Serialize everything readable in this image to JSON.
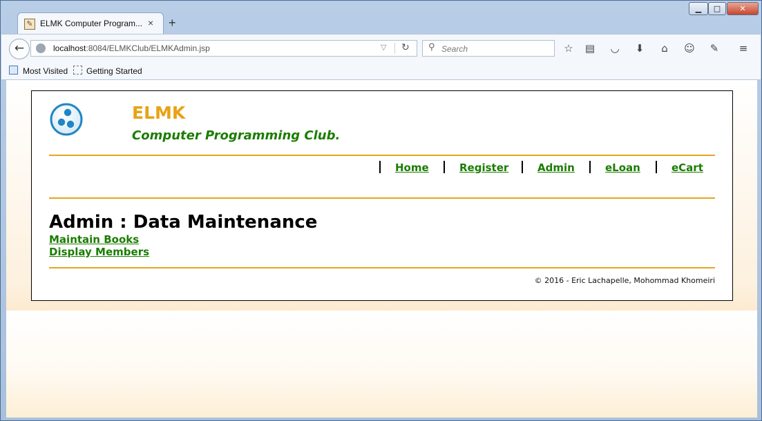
{
  "browser": {
    "tab_title": "ELMK Computer Program...",
    "tab_close": "×",
    "new_tab": "+",
    "url_host": "localhost",
    "url_path": ":8084/ELMKClub/ELMKAdmin.jsp",
    "search_placeholder": "Search",
    "bookmarks": [
      "Most Visited",
      "Getting Started"
    ]
  },
  "site": {
    "title": "ELMK",
    "subtitle": "Computer Programming Club.",
    "nav": [
      "Home",
      "Register",
      "Admin",
      "eLoan",
      "eCart"
    ]
  },
  "main": {
    "heading": "Admin : Data Maintenance",
    "links": [
      "Maintain Books",
      "Display Members"
    ]
  },
  "footer": {
    "text": "© 2016 - Eric Lachapelle, Mohommad Khomeiri"
  },
  "colors": {
    "title_orange": "#e8a214",
    "link_green": "#1a7d00",
    "rule_orange": "#e5a51e"
  }
}
